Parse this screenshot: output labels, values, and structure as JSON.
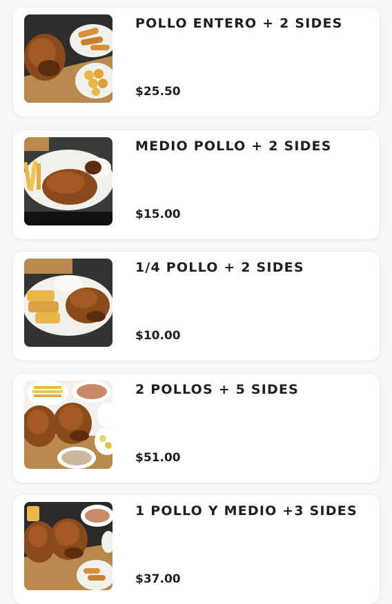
{
  "items": [
    {
      "title": "POLLO ENTERO + 2 SIDES",
      "price": "$25.50",
      "image_icon": "whole-chicken-photo"
    },
    {
      "title": "MEDIO POLLO + 2 SIDES",
      "price": "$15.00",
      "image_icon": "half-chicken-photo"
    },
    {
      "title": "1/4 POLLO + 2 SIDES",
      "price": "$10.00",
      "image_icon": "quarter-chicken-photo"
    },
    {
      "title": "2 POLLOS + 5 SIDES",
      "price": "$51.00",
      "image_icon": "two-chickens-photo"
    },
    {
      "title": "1 POLLO Y MEDIO +3 SIDES",
      "price": "$37.00",
      "image_icon": "chicken-and-half-photo"
    }
  ],
  "colors": {
    "background": "#f7f7f8",
    "card": "#ffffff",
    "text": "#1e1e1e",
    "chicken": "#8a4a1c",
    "chicken_dark": "#5a2d0f",
    "table": "#2b2b2b",
    "plate": "#f2f0ea",
    "fries": "#e9b84a"
  }
}
